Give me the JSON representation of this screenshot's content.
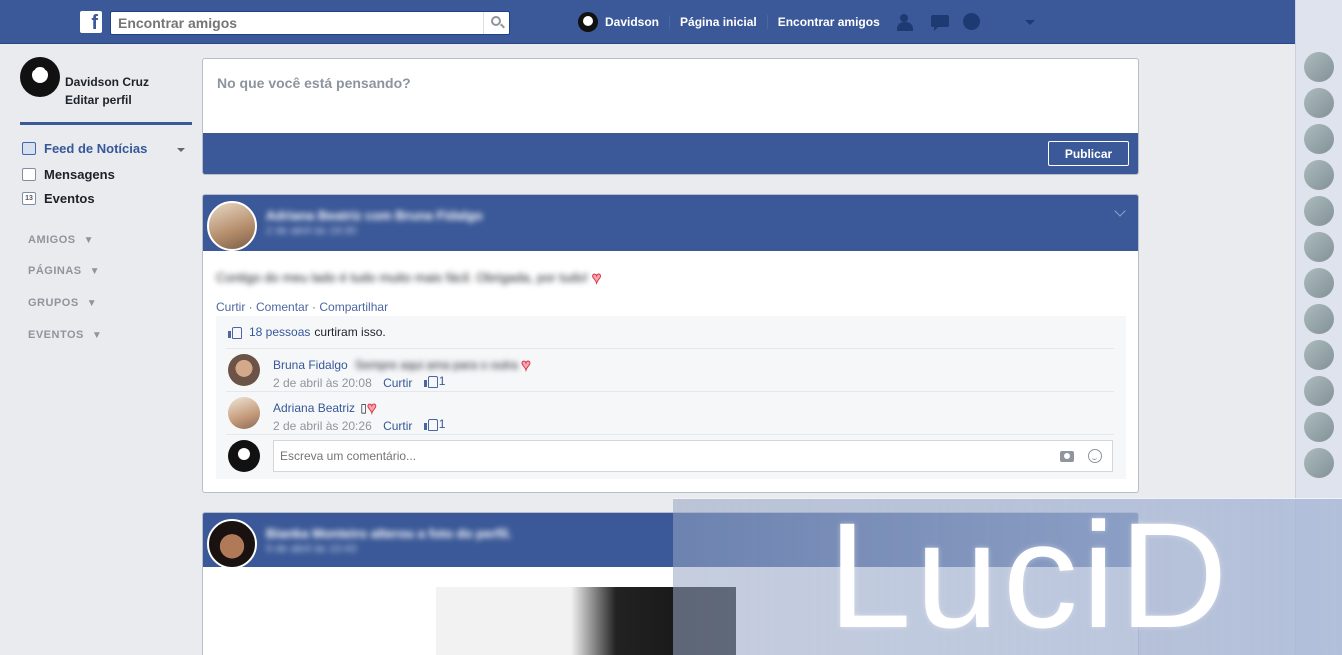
{
  "topbar": {
    "search_placeholder": "Encontrar amigos",
    "user_name": "Davidson",
    "home_label": "Página inicial",
    "find_friends_label": "Encontrar amigos"
  },
  "sidebar": {
    "profile_name": "Davidson Cruz",
    "edit_profile": "Editar perfil",
    "items": [
      {
        "label": "Feed de Notícias",
        "icon": "news-feed-icon"
      },
      {
        "label": "Mensagens",
        "icon": "messages-icon"
      },
      {
        "label": "Eventos",
        "icon": "calendar-icon",
        "icon_text": "13"
      }
    ],
    "sections": [
      "AMIGOS",
      "PÁGINAS",
      "GRUPOS",
      "EVENTOS"
    ]
  },
  "composer": {
    "placeholder": "No que você está pensando?",
    "publish_label": "Publicar"
  },
  "post": {
    "author": "Adriana Beatriz com Bruna Fidalgo",
    "timestamp": "2 de abril às 19:30",
    "text": "Contigo do meu lado é tudo muito mais fácil. Obrigada, por tudo!",
    "actions": {
      "like": "Curtir",
      "comment": "Comentar",
      "share": "Compartilhar",
      "separator": " · "
    },
    "likes": {
      "count": "18 pessoas",
      "suffix": "curtiram isso."
    },
    "comments": [
      {
        "name": "Bruna Fidalgo",
        "text": "Sempre aqui ama para o outra",
        "time": "2 de abril às 20:08",
        "like_label": "Curtir",
        "likes": "1"
      },
      {
        "name": "Adriana Beatriz",
        "text": "▯",
        "time": "2 de abril às 20:26",
        "like_label": "Curtir",
        "likes": "1"
      }
    ],
    "write_placeholder": "Escreva um comentário..."
  },
  "post2": {
    "author": "Bianka Monteiro alterou a foto do perfil.",
    "timestamp": "9 de abril às 10:43"
  },
  "watermark": "LuciD",
  "colors": {
    "brand": "#3b5998",
    "link": "#365899",
    "heart": "#f9a6b0"
  }
}
